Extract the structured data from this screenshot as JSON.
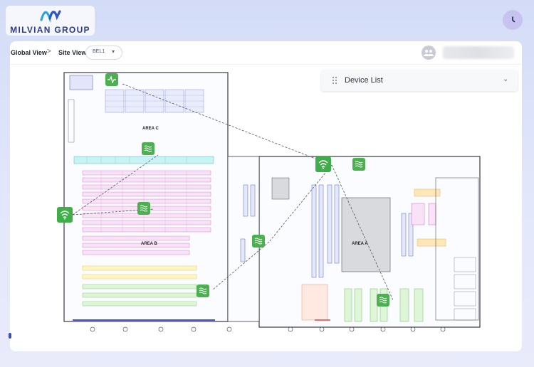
{
  "brand": {
    "name": "MILVIAN GROUP"
  },
  "breadcrumb": {
    "global": "Global View",
    "separator": ">",
    "site_label": "Site View:"
  },
  "site_select": {
    "value": "BEL1"
  },
  "device_list": {
    "title": "Device List"
  },
  "floorplan": {
    "area_c": "AREA C",
    "area_b": "AREA B",
    "area_a": "AREA A"
  },
  "colors": {
    "accent": "#3a4fb8",
    "marker": "#4caf50",
    "header_bg": "#d3dcf7"
  },
  "icons": {
    "clock": "clock-icon",
    "user": "user-avatar-icon",
    "drag": "drag-handle-icon",
    "chevron": "chevron-down-icon",
    "device_wifi": "wifi-icon",
    "device_wave": "wave-sensor-icon",
    "device_pulse": "pulse-icon"
  }
}
